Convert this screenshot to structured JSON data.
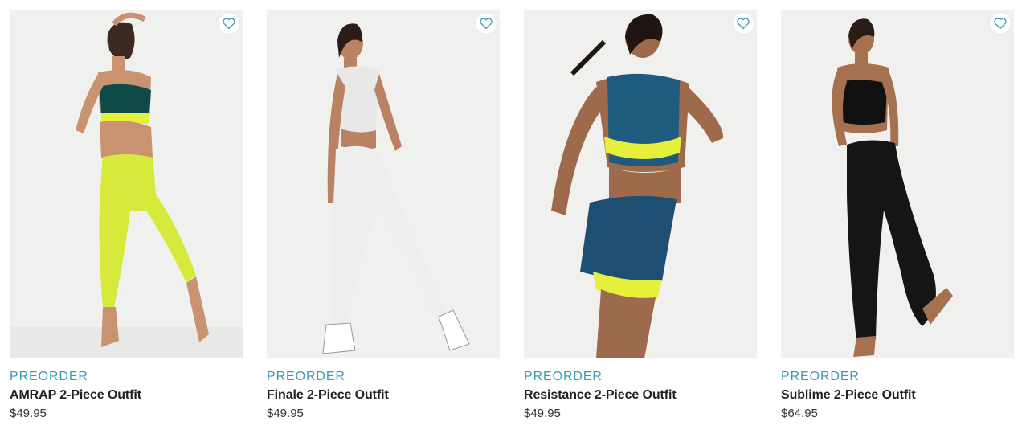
{
  "colors": {
    "accent": "#3a9cb0",
    "text": "#222222",
    "photo_bg": "#f0f0ef"
  },
  "products": [
    {
      "badge": "PREORDER",
      "name": "AMRAP 2-Piece Outfit",
      "price": "$49.95",
      "favorite_icon": "heart-outline-icon",
      "outfit_colors": {
        "top": "#0f4a4a",
        "trim": "#e6f03a",
        "bottom": "#d7ea3c",
        "skin": "#c99372",
        "hair": "#3a2a22"
      }
    },
    {
      "badge": "PREORDER",
      "name": "Finale 2-Piece Outfit",
      "price": "$49.95",
      "favorite_icon": "heart-outline-icon",
      "outfit_colors": {
        "top": "#e8e8e8",
        "trim": "#444444",
        "bottom": "#eeeeee",
        "skin": "#b98262",
        "hair": "#2a1d17"
      }
    },
    {
      "badge": "PREORDER",
      "name": "Resistance 2-Piece Outfit",
      "price": "$49.95",
      "favorite_icon": "heart-outline-icon",
      "outfit_colors": {
        "top": "#1f5a7f",
        "trim": "#e6f03a",
        "bottom": "#1e4f73",
        "skin": "#9d6a4b",
        "hair": "#1f1612"
      }
    },
    {
      "badge": "PREORDER",
      "name": "Sublime 2-Piece Outfit",
      "price": "$64.95",
      "favorite_icon": "heart-outline-icon",
      "outfit_colors": {
        "top": "#111111",
        "trim": "#111111",
        "bottom": "#151515",
        "skin": "#a6714f",
        "hair": "#2a1d17"
      }
    }
  ]
}
